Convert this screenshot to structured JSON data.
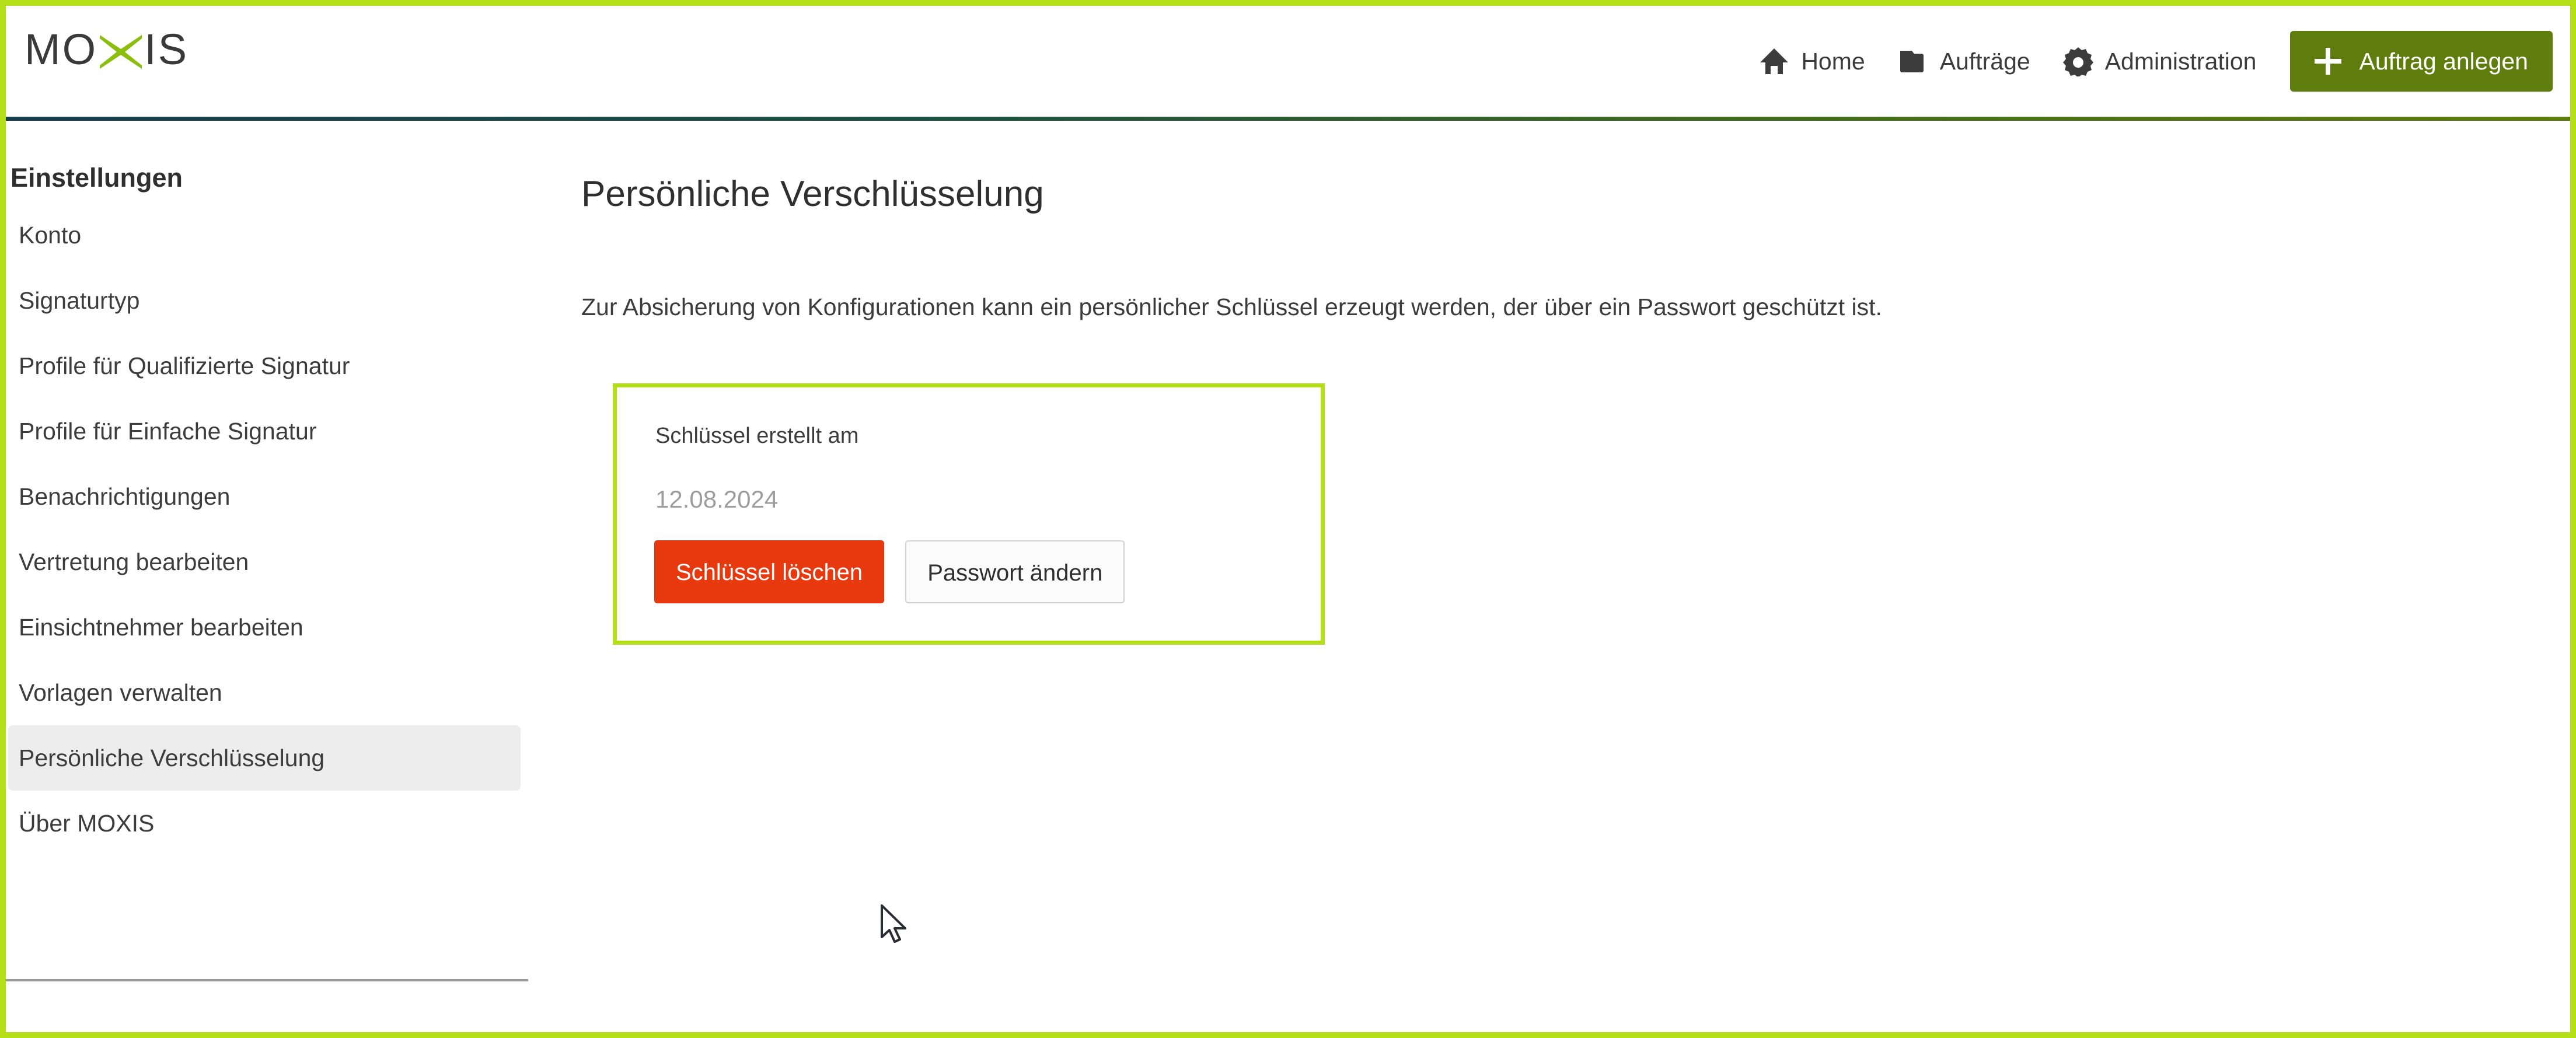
{
  "header": {
    "logo": {
      "text_before": "MO",
      "x_glyph": "x-logo-mark",
      "text_after": "IS",
      "alt": "MOXIS"
    },
    "nav": [
      {
        "label": "Home",
        "icon": "home-icon"
      },
      {
        "label": "Aufträge",
        "icon": "folder-icon"
      },
      {
        "label": "Administration",
        "icon": "gear-icon"
      }
    ],
    "cta": {
      "label": "Auftrag anlegen",
      "icon": "plus-icon",
      "color": "#5e7d0c"
    }
  },
  "sidebar": {
    "title": "Einstellungen",
    "items": [
      {
        "label": "Konto",
        "active": false
      },
      {
        "label": "Signaturtyp",
        "active": false
      },
      {
        "label": "Profile für Qualifizierte Signatur",
        "active": false
      },
      {
        "label": "Profile für Einfache Signatur",
        "active": false
      },
      {
        "label": "Benachrichtigungen",
        "active": false
      },
      {
        "label": "Vertretung bearbeiten",
        "active": false
      },
      {
        "label": "Einsichtnehmer bearbeiten",
        "active": false
      },
      {
        "label": "Vorlagen verwalten",
        "active": false
      },
      {
        "label": "Persönliche Verschlüsselung",
        "active": true
      },
      {
        "label": "Über MOXIS",
        "active": false
      }
    ]
  },
  "main": {
    "title": "Persönliche Verschlüsselung",
    "description": "Zur Absicherung von Konfigurationen kann ein persönlicher Schlüssel erzeugt werden, der über ein Passwort geschützt ist.",
    "key_card": {
      "label": "Schlüssel erstellt am",
      "date": "12.08.2024",
      "delete_button": "Schlüssel löschen",
      "change_password_button": "Passwort ändern",
      "border_color": "#b5e019",
      "delete_color": "#e8380d"
    }
  },
  "theme": {
    "accent_green": "#b5e019",
    "brand_green": "#5e7d0c",
    "danger_red": "#e8380d",
    "text_dark": "#3c3c3c",
    "muted_gray": "#9d9d9d",
    "active_bg": "#ededed"
  }
}
